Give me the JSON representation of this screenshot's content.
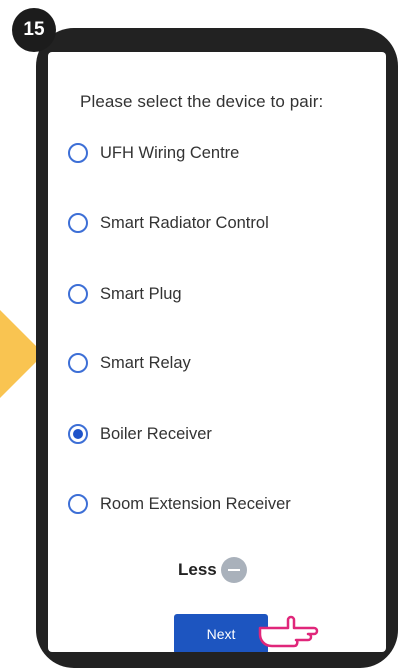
{
  "step": {
    "number": "15"
  },
  "header": {
    "title": "Please select the device to pair:"
  },
  "options": [
    {
      "label": "UFH Wiring Centre",
      "selected": false
    },
    {
      "label": "Smart Radiator Control",
      "selected": false
    },
    {
      "label": "Smart Plug",
      "selected": false
    },
    {
      "label": "Smart Relay",
      "selected": false
    },
    {
      "label": "Boiler Receiver",
      "selected": true
    },
    {
      "label": "Room Extension Receiver",
      "selected": false
    }
  ],
  "toggle": {
    "label": "Less"
  },
  "actions": {
    "next_label": "Next"
  },
  "colors": {
    "accent": "#1d55c0",
    "arrow": "#f9c451",
    "frame": "#222222"
  }
}
